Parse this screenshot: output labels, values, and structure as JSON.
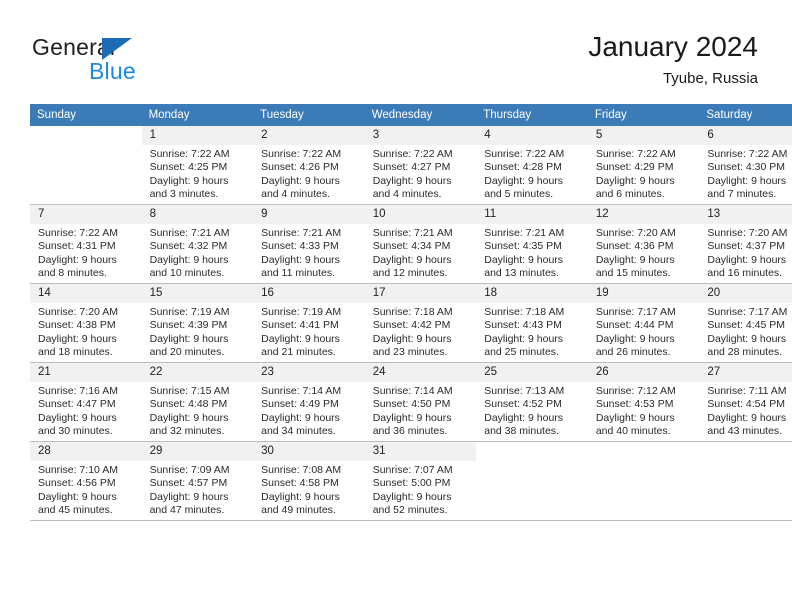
{
  "brand": {
    "name_part1": "General",
    "name_part2": "Blue",
    "triangle_color": "#1b6cb5",
    "blue_color": "#1b8ae0"
  },
  "header": {
    "title": "January 2024",
    "subtitle": "Tyube, Russia",
    "accent_color": "#3b7cb8"
  },
  "calendar": {
    "weekdays": [
      "Sunday",
      "Monday",
      "Tuesday",
      "Wednesday",
      "Thursday",
      "Friday",
      "Saturday"
    ],
    "weeks": [
      [
        {
          "day": "",
          "blank": true,
          "sunrise": "",
          "sunset": "",
          "daylight_line1": "",
          "daylight_line2": ""
        },
        {
          "day": "1",
          "sunrise": "Sunrise: 7:22 AM",
          "sunset": "Sunset: 4:25 PM",
          "daylight_line1": "Daylight: 9 hours",
          "daylight_line2": "and 3 minutes."
        },
        {
          "day": "2",
          "sunrise": "Sunrise: 7:22 AM",
          "sunset": "Sunset: 4:26 PM",
          "daylight_line1": "Daylight: 9 hours",
          "daylight_line2": "and 4 minutes."
        },
        {
          "day": "3",
          "sunrise": "Sunrise: 7:22 AM",
          "sunset": "Sunset: 4:27 PM",
          "daylight_line1": "Daylight: 9 hours",
          "daylight_line2": "and 4 minutes."
        },
        {
          "day": "4",
          "sunrise": "Sunrise: 7:22 AM",
          "sunset": "Sunset: 4:28 PM",
          "daylight_line1": "Daylight: 9 hours",
          "daylight_line2": "and 5 minutes."
        },
        {
          "day": "5",
          "sunrise": "Sunrise: 7:22 AM",
          "sunset": "Sunset: 4:29 PM",
          "daylight_line1": "Daylight: 9 hours",
          "daylight_line2": "and 6 minutes."
        },
        {
          "day": "6",
          "sunrise": "Sunrise: 7:22 AM",
          "sunset": "Sunset: 4:30 PM",
          "daylight_line1": "Daylight: 9 hours",
          "daylight_line2": "and 7 minutes."
        }
      ],
      [
        {
          "day": "7",
          "sunrise": "Sunrise: 7:22 AM",
          "sunset": "Sunset: 4:31 PM",
          "daylight_line1": "Daylight: 9 hours",
          "daylight_line2": "and 8 minutes."
        },
        {
          "day": "8",
          "sunrise": "Sunrise: 7:21 AM",
          "sunset": "Sunset: 4:32 PM",
          "daylight_line1": "Daylight: 9 hours",
          "daylight_line2": "and 10 minutes."
        },
        {
          "day": "9",
          "sunrise": "Sunrise: 7:21 AM",
          "sunset": "Sunset: 4:33 PM",
          "daylight_line1": "Daylight: 9 hours",
          "daylight_line2": "and 11 minutes."
        },
        {
          "day": "10",
          "sunrise": "Sunrise: 7:21 AM",
          "sunset": "Sunset: 4:34 PM",
          "daylight_line1": "Daylight: 9 hours",
          "daylight_line2": "and 12 minutes."
        },
        {
          "day": "11",
          "sunrise": "Sunrise: 7:21 AM",
          "sunset": "Sunset: 4:35 PM",
          "daylight_line1": "Daylight: 9 hours",
          "daylight_line2": "and 13 minutes."
        },
        {
          "day": "12",
          "sunrise": "Sunrise: 7:20 AM",
          "sunset": "Sunset: 4:36 PM",
          "daylight_line1": "Daylight: 9 hours",
          "daylight_line2": "and 15 minutes."
        },
        {
          "day": "13",
          "sunrise": "Sunrise: 7:20 AM",
          "sunset": "Sunset: 4:37 PM",
          "daylight_line1": "Daylight: 9 hours",
          "daylight_line2": "and 16 minutes."
        }
      ],
      [
        {
          "day": "14",
          "sunrise": "Sunrise: 7:20 AM",
          "sunset": "Sunset: 4:38 PM",
          "daylight_line1": "Daylight: 9 hours",
          "daylight_line2": "and 18 minutes."
        },
        {
          "day": "15",
          "sunrise": "Sunrise: 7:19 AM",
          "sunset": "Sunset: 4:39 PM",
          "daylight_line1": "Daylight: 9 hours",
          "daylight_line2": "and 20 minutes."
        },
        {
          "day": "16",
          "sunrise": "Sunrise: 7:19 AM",
          "sunset": "Sunset: 4:41 PM",
          "daylight_line1": "Daylight: 9 hours",
          "daylight_line2": "and 21 minutes."
        },
        {
          "day": "17",
          "sunrise": "Sunrise: 7:18 AM",
          "sunset": "Sunset: 4:42 PM",
          "daylight_line1": "Daylight: 9 hours",
          "daylight_line2": "and 23 minutes."
        },
        {
          "day": "18",
          "sunrise": "Sunrise: 7:18 AM",
          "sunset": "Sunset: 4:43 PM",
          "daylight_line1": "Daylight: 9 hours",
          "daylight_line2": "and 25 minutes."
        },
        {
          "day": "19",
          "sunrise": "Sunrise: 7:17 AM",
          "sunset": "Sunset: 4:44 PM",
          "daylight_line1": "Daylight: 9 hours",
          "daylight_line2": "and 26 minutes."
        },
        {
          "day": "20",
          "sunrise": "Sunrise: 7:17 AM",
          "sunset": "Sunset: 4:45 PM",
          "daylight_line1": "Daylight: 9 hours",
          "daylight_line2": "and 28 minutes."
        }
      ],
      [
        {
          "day": "21",
          "sunrise": "Sunrise: 7:16 AM",
          "sunset": "Sunset: 4:47 PM",
          "daylight_line1": "Daylight: 9 hours",
          "daylight_line2": "and 30 minutes."
        },
        {
          "day": "22",
          "sunrise": "Sunrise: 7:15 AM",
          "sunset": "Sunset: 4:48 PM",
          "daylight_line1": "Daylight: 9 hours",
          "daylight_line2": "and 32 minutes."
        },
        {
          "day": "23",
          "sunrise": "Sunrise: 7:14 AM",
          "sunset": "Sunset: 4:49 PM",
          "daylight_line1": "Daylight: 9 hours",
          "daylight_line2": "and 34 minutes."
        },
        {
          "day": "24",
          "sunrise": "Sunrise: 7:14 AM",
          "sunset": "Sunset: 4:50 PM",
          "daylight_line1": "Daylight: 9 hours",
          "daylight_line2": "and 36 minutes."
        },
        {
          "day": "25",
          "sunrise": "Sunrise: 7:13 AM",
          "sunset": "Sunset: 4:52 PM",
          "daylight_line1": "Daylight: 9 hours",
          "daylight_line2": "and 38 minutes."
        },
        {
          "day": "26",
          "sunrise": "Sunrise: 7:12 AM",
          "sunset": "Sunset: 4:53 PM",
          "daylight_line1": "Daylight: 9 hours",
          "daylight_line2": "and 40 minutes."
        },
        {
          "day": "27",
          "sunrise": "Sunrise: 7:11 AM",
          "sunset": "Sunset: 4:54 PM",
          "daylight_line1": "Daylight: 9 hours",
          "daylight_line2": "and 43 minutes."
        }
      ],
      [
        {
          "day": "28",
          "sunrise": "Sunrise: 7:10 AM",
          "sunset": "Sunset: 4:56 PM",
          "daylight_line1": "Daylight: 9 hours",
          "daylight_line2": "and 45 minutes."
        },
        {
          "day": "29",
          "sunrise": "Sunrise: 7:09 AM",
          "sunset": "Sunset: 4:57 PM",
          "daylight_line1": "Daylight: 9 hours",
          "daylight_line2": "and 47 minutes."
        },
        {
          "day": "30",
          "sunrise": "Sunrise: 7:08 AM",
          "sunset": "Sunset: 4:58 PM",
          "daylight_line1": "Daylight: 9 hours",
          "daylight_line2": "and 49 minutes."
        },
        {
          "day": "31",
          "sunrise": "Sunrise: 7:07 AM",
          "sunset": "Sunset: 5:00 PM",
          "daylight_line1": "Daylight: 9 hours",
          "daylight_line2": "and 52 minutes."
        },
        {
          "day": "",
          "blank": true,
          "sunrise": "",
          "sunset": "",
          "daylight_line1": "",
          "daylight_line2": ""
        },
        {
          "day": "",
          "blank": true,
          "sunrise": "",
          "sunset": "",
          "daylight_line1": "",
          "daylight_line2": ""
        },
        {
          "day": "",
          "blank": true,
          "sunrise": "",
          "sunset": "",
          "daylight_line1": "",
          "daylight_line2": ""
        }
      ]
    ]
  }
}
